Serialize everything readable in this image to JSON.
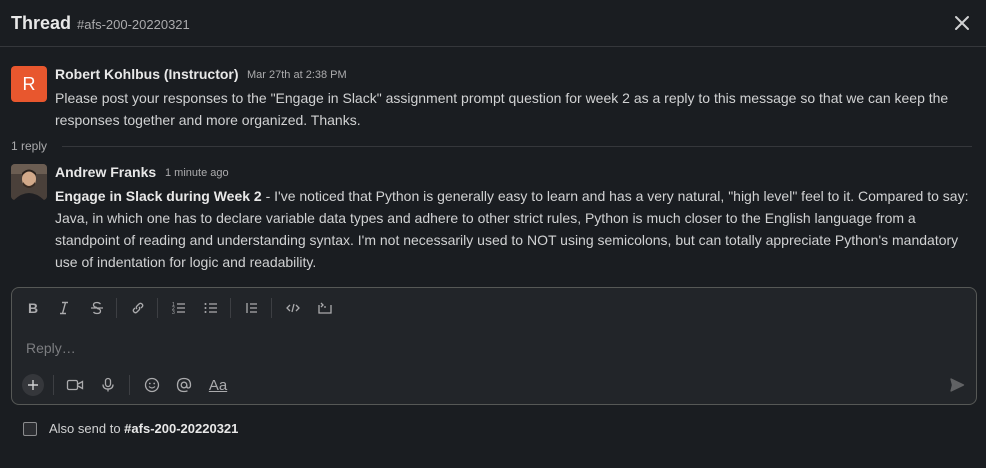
{
  "header": {
    "title": "Thread",
    "channel": "#afs-200-20220321",
    "close_icon": "close-icon"
  },
  "messages": [
    {
      "avatar_initial": "R",
      "avatar_color": "#e8572e",
      "author": "Robert Kohlbus (Instructor)",
      "time": "Mar 27th at 2:38 PM",
      "text": "Please post your responses to the \"Engage in Slack\" assignment prompt question for week 2 as a reply to this message so that we can keep the responses together and more organized. Thanks."
    },
    {
      "avatar": "user-photo",
      "author": "Andrew Franks",
      "time": "1 minute ago",
      "text_bold": "Engage in Slack during Week 2",
      "text": " - I've noticed that Python is generally easy to learn and has a very natural, \"high level\" feel to it. Compared to say: Java, in which one has to declare variable data types and adhere to other strict rules, Python is much closer to the English language from a standpoint of reading and understanding syntax. I'm not necessarily used to NOT using semicolons, but can totally appreciate Python's mandatory use of indentation for logic and readability."
    }
  ],
  "reply_count": "1 reply",
  "composer": {
    "placeholder": "Reply…",
    "value": "",
    "toolbar_icons": [
      "bold-icon",
      "italic-icon",
      "strikethrough-icon",
      "link-icon",
      "ordered-list-icon",
      "bulleted-list-icon",
      "blockquote-icon",
      "code-icon",
      "code-block-icon"
    ],
    "bottom_icons": [
      "plus-icon",
      "video-icon",
      "microphone-icon",
      "emoji-icon",
      "mention-icon",
      "formatting-icon",
      "send-icon"
    ],
    "format_label": "Aa"
  },
  "also_send": {
    "label": "Also send to",
    "channel": "#afs-200-20220321",
    "checked": false
  }
}
